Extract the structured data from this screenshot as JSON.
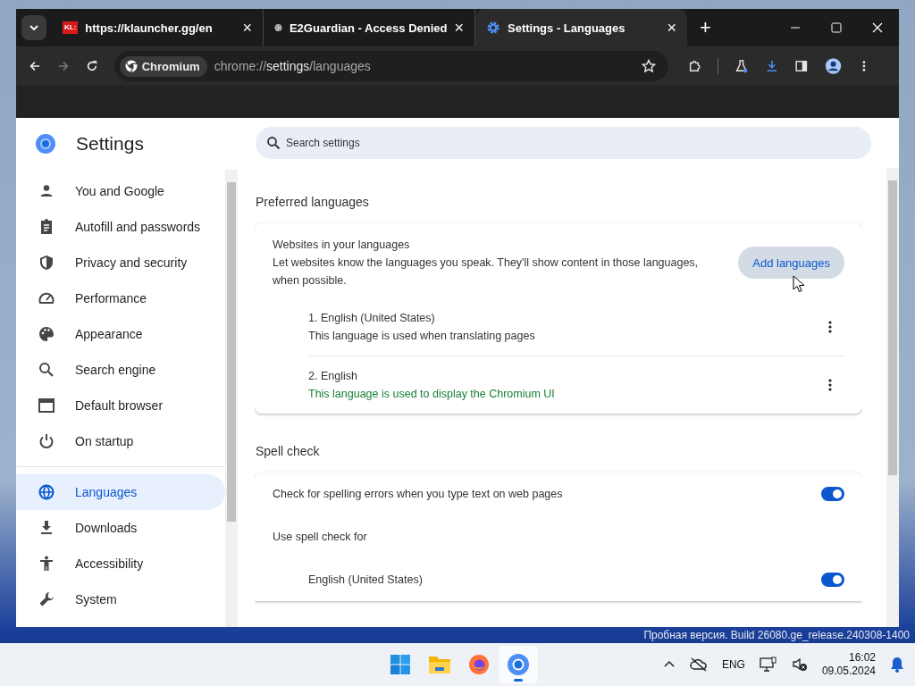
{
  "browser": {
    "tabs": [
      {
        "title": "https://klauncher.gg/en",
        "selected": false,
        "kind": "badge",
        "badge_text": "KL:",
        "close": "×"
      },
      {
        "title": "E2Guardian - Access Denied",
        "selected": false,
        "kind": "globe",
        "close": "×"
      },
      {
        "title": "Settings - Languages",
        "selected": true,
        "kind": "gear",
        "close": "×"
      }
    ],
    "new_tab": "+",
    "address": {
      "chip": "Chromium",
      "scheme": "chrome://",
      "host": "settings",
      "path": "/languages"
    }
  },
  "sidebar": {
    "title": "Settings",
    "groups": [
      [
        {
          "label": "You and Google",
          "kind": "person",
          "selected": false
        },
        {
          "label": "Autofill and passwords",
          "kind": "clipboard",
          "selected": false
        },
        {
          "label": "Privacy and security",
          "kind": "shield",
          "selected": false
        },
        {
          "label": "Performance",
          "kind": "gauge",
          "selected": false
        },
        {
          "label": "Appearance",
          "kind": "palette",
          "selected": false
        },
        {
          "label": "Search engine",
          "kind": "search",
          "selected": false
        },
        {
          "label": "Default browser",
          "kind": "window",
          "selected": false
        },
        {
          "label": "On startup",
          "kind": "power",
          "selected": false
        }
      ],
      [
        {
          "label": "Languages",
          "kind": "globe",
          "selected": true
        },
        {
          "label": "Downloads",
          "kind": "download",
          "selected": false
        },
        {
          "label": "Accessibility",
          "kind": "accessibility",
          "selected": false
        },
        {
          "label": "System",
          "kind": "wrench",
          "selected": false
        }
      ]
    ]
  },
  "search": {
    "placeholder": "Search settings"
  },
  "preferred": {
    "heading": "Preferred languages",
    "title": "Websites in your languages",
    "description": "Let websites know the languages you speak. They'll show content in those languages, when possible.",
    "button": "Add languages",
    "languages": [
      {
        "name": "1. English (United States)",
        "note": "This language is used when translating pages",
        "highlight": false
      },
      {
        "name": "2. English",
        "note": "This language is used to display the Chromium UI",
        "highlight": true
      }
    ]
  },
  "spell": {
    "heading": "Spell check",
    "main": {
      "label": "Check for spelling errors when you type text on web pages",
      "on": true
    },
    "subheading": "Use spell check for",
    "languages": [
      {
        "label": "English (United States)",
        "on": true
      }
    ]
  },
  "desktop": {
    "watermark": "Пробная версия. Build 26080.ge_release.240308-1400"
  },
  "taskbar": {
    "apps": [
      {
        "kind": "start",
        "active": false
      },
      {
        "kind": "folder",
        "active": false
      },
      {
        "kind": "firefox",
        "active": false
      },
      {
        "kind": "chromium",
        "active": true
      }
    ],
    "language": "ENG",
    "time": "16:02",
    "date": "09.05.2024"
  }
}
